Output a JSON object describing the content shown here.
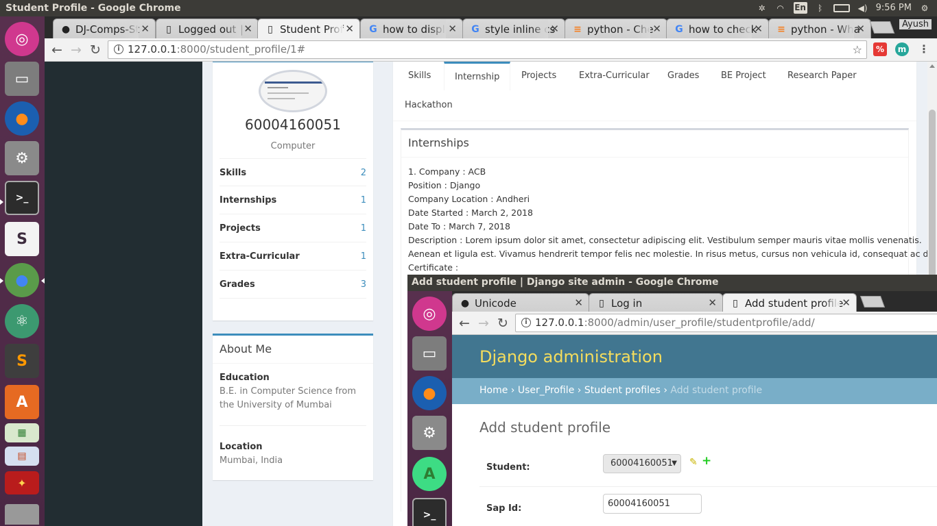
{
  "os": {
    "window_title": "Student Profile - Google Chrome",
    "keyboard_layout": "En",
    "clock": "9:56 PM"
  },
  "launcher_icons": [
    "ubuntu-dash-icon",
    "files-icon",
    "firefox-icon",
    "system-settings-icon",
    "terminal-icon",
    "slack-icon",
    "chrome-icon",
    "atom-icon",
    "sublime-text-icon",
    "software-center-icon",
    "libreoffice-calc-icon",
    "libreoffice-impress-icon",
    "game-icon",
    "trash-icon"
  ],
  "browser": {
    "tabs": [
      {
        "title": "DJ-Comps-St",
        "icon": "github-icon"
      },
      {
        "title": "Logged out |",
        "icon": "page-icon"
      },
      {
        "title": "Student Prof",
        "icon": "page-icon",
        "active": true
      },
      {
        "title": "how to displ",
        "icon": "google-icon"
      },
      {
        "title": "style inline cs",
        "icon": "google-icon"
      },
      {
        "title": "python - Che",
        "icon": "stackoverflow-icon"
      },
      {
        "title": "how to check",
        "icon": "google-icon"
      },
      {
        "title": "python - Wha",
        "icon": "stackoverflow-icon"
      }
    ],
    "profile_name": "Ayush",
    "url_host": "127.0.0.1",
    "url_rest": ":8000/student_profile/1#"
  },
  "profile": {
    "sap_id": "60004160051",
    "department": "Computer",
    "stats": [
      {
        "label": "Skills",
        "value": "2"
      },
      {
        "label": "Internships",
        "value": "1"
      },
      {
        "label": "Projects",
        "value": "1"
      },
      {
        "label": "Extra-Curricular",
        "value": "1"
      },
      {
        "label": "Grades",
        "value": "3"
      }
    ]
  },
  "about": {
    "title": "About Me",
    "education_label": "Education",
    "education_text": "B.E. in Computer Science from the University of Mumbai",
    "location_label": "Location",
    "location_text": "Mumbai, India"
  },
  "profile_tabs": [
    "Skills",
    "Internship",
    "Projects",
    "Extra-Curricular",
    "Grades",
    "BE Project",
    "Research Paper",
    "Hackathon"
  ],
  "internships": {
    "title": "Internships",
    "lines": [
      "1. Company : ACB",
      "Position : Django",
      "Company Location : Andheri",
      "Date Started : March 2, 2018",
      "Date To : March 7, 2018",
      "Description : Lorem ipsum dolor sit amet, consectetur adipiscing elit. Vestibulum semper mauris vitae mollis venenatis.",
      "Aenean et ligula est. Vivamus hendrerit tempor felis nec molestie. In risus metus, cursus non vehicula id, consequat ac diam.",
      "Certificate :"
    ]
  },
  "admin_window": {
    "title": "Add student profile | Django site admin - Google Chrome",
    "tabs": [
      {
        "title": "Unicode",
        "icon": "github-icon"
      },
      {
        "title": "Log in",
        "icon": "page-icon"
      },
      {
        "title": "Add student profile",
        "icon": "page-icon",
        "active": true
      }
    ],
    "url_host": "127.0.0.1",
    "url_rest": ":8000/admin/user_profile/studentprofile/add/",
    "brand": "Django administration",
    "breadcrumbs": [
      "Home",
      "User_Profile",
      "Student profiles"
    ],
    "breadcrumb_current": "Add student profile",
    "breadcrumb_sep": "›",
    "heading": "Add student profile",
    "student_label": "Student:",
    "student_value": "60004160051",
    "sap_label": "Sap Id:",
    "sap_value": "60004160051"
  },
  "colors": {
    "adminlte_blue": "#3c8dbc",
    "django_header": "#417690",
    "django_brand": "#f5dd5d",
    "django_breadcrumb": "#79aec8"
  }
}
